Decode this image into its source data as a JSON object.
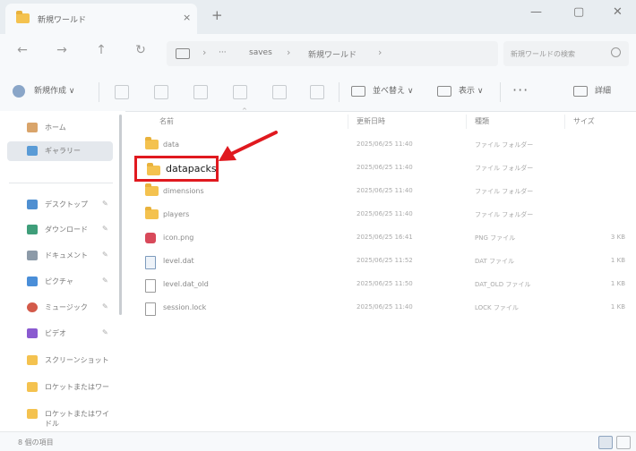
{
  "window": {
    "tab_title": "新規ワールド",
    "tab_close": "×",
    "new_tab": "+",
    "controls": {
      "minimize": "—",
      "maximize": "▢",
      "close": "✕"
    }
  },
  "nav": {
    "back": "←",
    "forward": "→",
    "up": "↑",
    "refresh": "↻"
  },
  "address": {
    "sep1": "›",
    "overflow": "···",
    "crumbs": [
      "saves",
      "新規ワールド"
    ],
    "sep2": "›",
    "sep3": "›"
  },
  "search": {
    "placeholder": "新規ワールドの検索"
  },
  "toolbar": {
    "new_label": "新規作成 ∨",
    "sort_label": "並べ替え ∨",
    "view_label": "表示 ∨",
    "more": "···",
    "details_label": "詳細"
  },
  "sidebar": {
    "items": [
      {
        "label": "ホーム",
        "icon": "home-icon",
        "pinned": false
      },
      {
        "label": "ギャラリー",
        "icon": "gallery-icon",
        "pinned": false
      },
      {
        "label": "デスクトップ",
        "icon": "desktop-icon",
        "pinned": true
      },
      {
        "label": "ダウンロード",
        "icon": "download-icon",
        "pinned": true
      },
      {
        "label": "ドキュメント",
        "icon": "document-icon",
        "pinned": true
      },
      {
        "label": "ピクチャ",
        "icon": "picture-icon",
        "pinned": true
      },
      {
        "label": "ミュージック",
        "icon": "music-icon",
        "pinned": true
      },
      {
        "label": "ビデオ",
        "icon": "video-icon",
        "pinned": true
      },
      {
        "label": "スクリーンショット",
        "icon": "folder-icon",
        "pinned": false
      },
      {
        "label": "ロケットまたはワー",
        "icon": "folder-icon",
        "pinned": false
      },
      {
        "label": "ロケットまたはワイドル",
        "icon": "folder-icon",
        "pinned": false
      }
    ],
    "pin_glyph": "✎"
  },
  "columns": {
    "name": "名前",
    "date": "更新日時",
    "type": "種類",
    "size": "サイズ",
    "sort_caret": "^"
  },
  "files": [
    {
      "name": "data",
      "date": "2025/06/25 11:40",
      "type": "ファイル フォルダー",
      "size": "",
      "icon": "folder"
    },
    {
      "name": "datapacks",
      "date": "2025/06/25 11:40",
      "type": "ファイル フォルダー",
      "size": "",
      "icon": "folder"
    },
    {
      "name": "dimensions",
      "date": "2025/06/25 11:40",
      "type": "ファイル フォルダー",
      "size": "",
      "icon": "folder"
    },
    {
      "name": "players",
      "date": "2025/06/25 11:40",
      "type": "ファイル フォルダー",
      "size": "",
      "icon": "folder"
    },
    {
      "name": "icon.png",
      "date": "2025/06/25 16:41",
      "type": "PNG ファイル",
      "size": "3 KB",
      "icon": "png"
    },
    {
      "name": "level.dat",
      "date": "2025/06/25 11:52",
      "type": "DAT ファイル",
      "size": "1 KB",
      "icon": "dat"
    },
    {
      "name": "level.dat_old",
      "date": "2025/06/25 11:50",
      "type": "DAT_OLD ファイル",
      "size": "1 KB",
      "icon": "file"
    },
    {
      "name": "session.lock",
      "date": "2025/06/25 11:40",
      "type": "LOCK ファイル",
      "size": "1 KB",
      "icon": "file"
    }
  ],
  "highlight": {
    "label": "datapacks"
  },
  "status": {
    "item_count": "8 個の項目"
  },
  "colors": {
    "highlight": "#e0191f",
    "folder": "#f4c24f",
    "active_nav": "#e4e8ed"
  }
}
